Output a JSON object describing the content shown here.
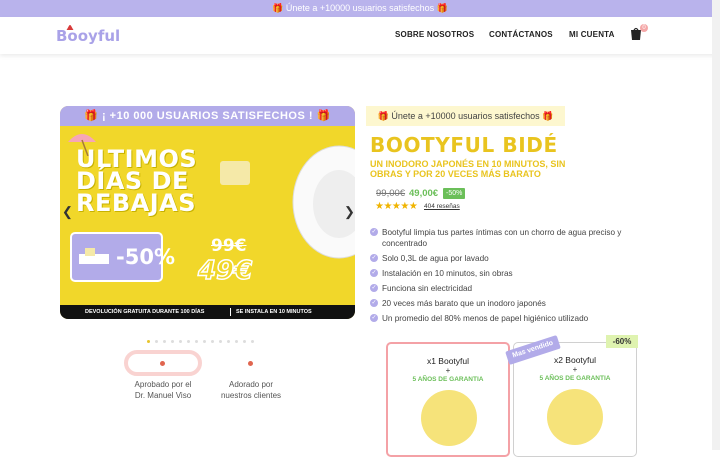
{
  "topbar": {
    "text": "🎁 Únete a +10000 usuarios satisfechos 🎁"
  },
  "header": {
    "logo": "Booyful",
    "nav": [
      "SOBRE NOSOTROS",
      "CONTÁCTANOS",
      "MI CUENTA"
    ],
    "cart_count": "0"
  },
  "banner": {
    "top_text": "🎁 ¡ +10 000 USUARIOS SATISFECHOS ! 🎁",
    "headline_1": "ULTIMOS",
    "headline_2": "DÍAS DE",
    "headline_3": "REBAJAS",
    "discount": "-50%",
    "old_price": "99€",
    "new_price": "49€",
    "bottom_left": "DEVOLUCIÓN GRATUITA DURANTE 100 DÍAS",
    "bottom_right": "SE INSTALA EN 10 MINUTOS"
  },
  "badges": [
    {
      "text_1": "Aprobado por el",
      "text_2": "Dr. Manuel Viso"
    },
    {
      "text_1": "Adorado por",
      "text_2": "nuestros clientes"
    }
  ],
  "product": {
    "promo": "🎁 Únete a +10000 usuarios satisfechos 🎁",
    "title": "BOOTYFUL BIDÉ",
    "subtitle": "UN INODORO JAPONÉS EN 10 MINUTOS, SIN OBRAS Y POR 20 VECES MÁS BARATO",
    "price_old": "99,00€",
    "price_new": "49,00€",
    "price_pct": "-50%",
    "stars": "★★★★★",
    "reviews": "404 reseñas",
    "features": [
      "Bootyful limpia tus partes íntimas con un chorro de agua preciso y concentrado",
      "Solo 0,3L de agua por lavado",
      "Instalación en 10 minutos, sin obras",
      "Funciona sin electricidad",
      "20 veces más barato que un inodoro japonés",
      "Un promedio del 80% menos de papel higiénico utilizado"
    ]
  },
  "offers": [
    {
      "title": "x1 Bootyful",
      "plus": "+",
      "guarantee": "5 AÑOS DE GARANTIA"
    },
    {
      "title": "x2 Bootyful",
      "plus": "+",
      "guarantee": "5 AÑOS DE GARANTIA",
      "ribbon": "Mas vendido",
      "discount": "-60%"
    }
  ],
  "colors": {
    "accent": "#b2abe9",
    "brand_yellow": "#e9c41f",
    "green": "#6bbf59"
  }
}
